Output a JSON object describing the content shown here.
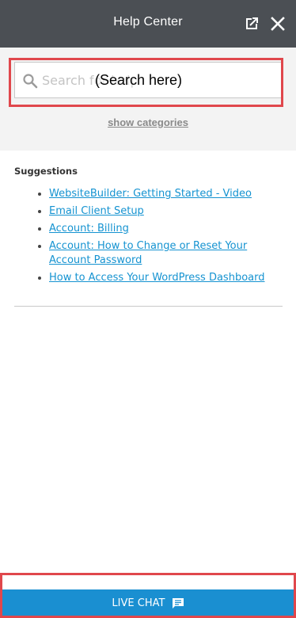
{
  "header": {
    "title": "Help Center"
  },
  "search": {
    "placeholder": "Search for help",
    "overlay_label": "(Search here)"
  },
  "show_categories": "show categories",
  "suggestions": {
    "title": "Suggestions",
    "items": [
      {
        "label": "WebsiteBuilder: Getting Started - Video"
      },
      {
        "label": "Email Client Setup"
      },
      {
        "label": "Account: Billing"
      },
      {
        "label": "Account: How to Change or Reset Your Account Password"
      },
      {
        "label": "How to Access Your WordPress Dashboard"
      }
    ]
  },
  "footer": {
    "live_chat_label": "LIVE CHAT"
  },
  "colors": {
    "header_bg": "#4b4f54",
    "link": "#1593d1",
    "live_chat_bg": "#1a8fd1",
    "highlight": "#e0474c"
  },
  "icons": [
    "external-link-icon",
    "close-icon",
    "search-icon",
    "chat-icon"
  ]
}
